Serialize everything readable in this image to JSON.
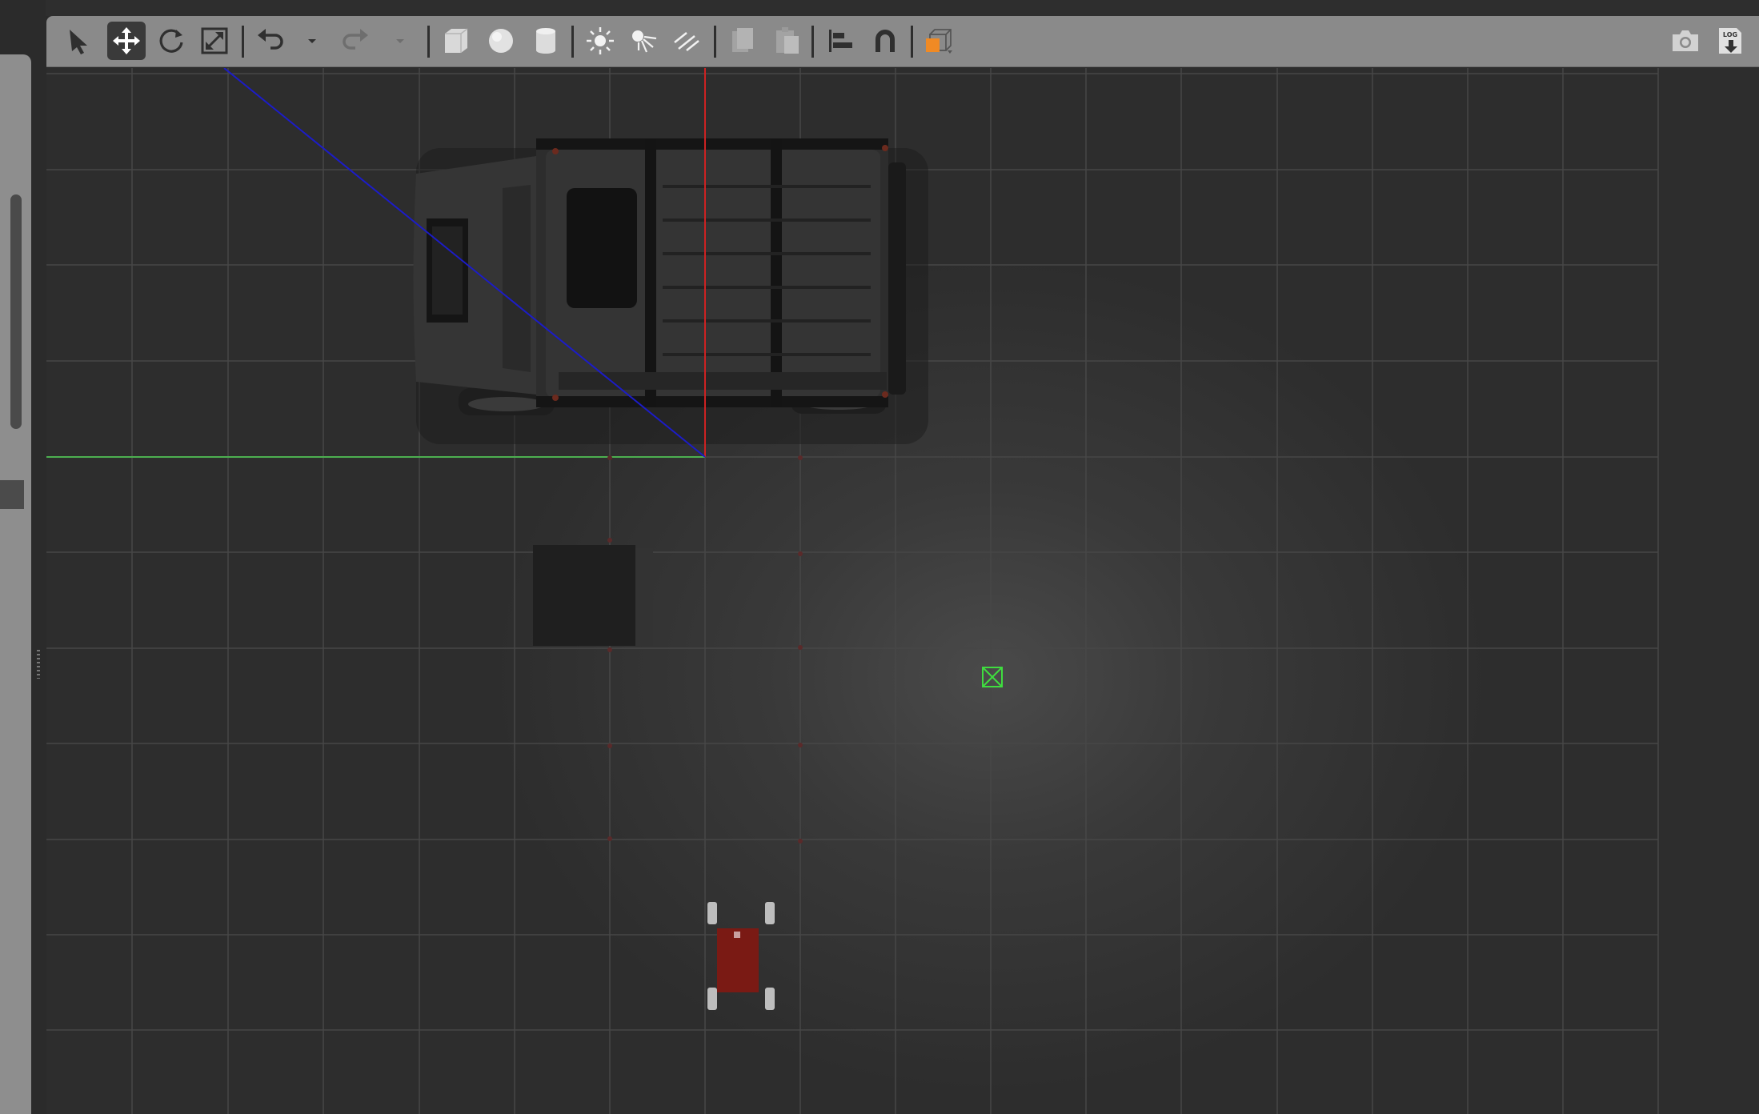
{
  "toolbar": {
    "tools": [
      {
        "name": "select-tool",
        "icon": "arrow-pointer-icon"
      },
      {
        "name": "translate-tool",
        "icon": "move-arrows-icon",
        "active": true
      },
      {
        "name": "rotate-tool",
        "icon": "rotate-icon"
      },
      {
        "name": "scale-tool",
        "icon": "scale-icon"
      }
    ],
    "history": [
      {
        "name": "undo-button",
        "icon": "undo-icon"
      },
      {
        "name": "undo-history-dropdown",
        "icon": "chevron-down-icon"
      },
      {
        "name": "redo-button",
        "icon": "redo-icon",
        "disabled": true
      },
      {
        "name": "redo-history-dropdown",
        "icon": "chevron-down-icon",
        "disabled": true
      }
    ],
    "shapes": [
      {
        "name": "box-shape-button",
        "icon": "box-icon"
      },
      {
        "name": "sphere-shape-button",
        "icon": "sphere-icon"
      },
      {
        "name": "cylinder-shape-button",
        "icon": "cylinder-icon"
      }
    ],
    "lights": [
      {
        "name": "point-light-button",
        "icon": "sun-icon"
      },
      {
        "name": "spot-light-button",
        "icon": "spotlight-icon"
      },
      {
        "name": "directional-light-button",
        "icon": "directional-light-icon"
      }
    ],
    "edit": [
      {
        "name": "copy-button",
        "icon": "copy-icon",
        "disabled": true
      },
      {
        "name": "paste-button",
        "icon": "paste-icon",
        "disabled": true
      },
      {
        "name": "align-button",
        "icon": "align-left-icon"
      },
      {
        "name": "snap-button",
        "icon": "magnet-icon"
      },
      {
        "name": "view-angle-button",
        "icon": "view-cube-icon"
      }
    ],
    "right": [
      {
        "name": "screenshot-button",
        "icon": "camera-icon"
      },
      {
        "name": "log-button",
        "icon": "log-download-icon",
        "label": "LOG"
      }
    ]
  },
  "colors": {
    "toolbar": "#8a8a8a",
    "grid": "#4a4a4a",
    "axis_x": "#cc2222",
    "axis_y": "#4caf50",
    "axis_z": "#1c1cc8",
    "accent_orange": "#f08a24",
    "robot_body": "#7a1a14",
    "origin_marker": "#3fdc3f"
  }
}
